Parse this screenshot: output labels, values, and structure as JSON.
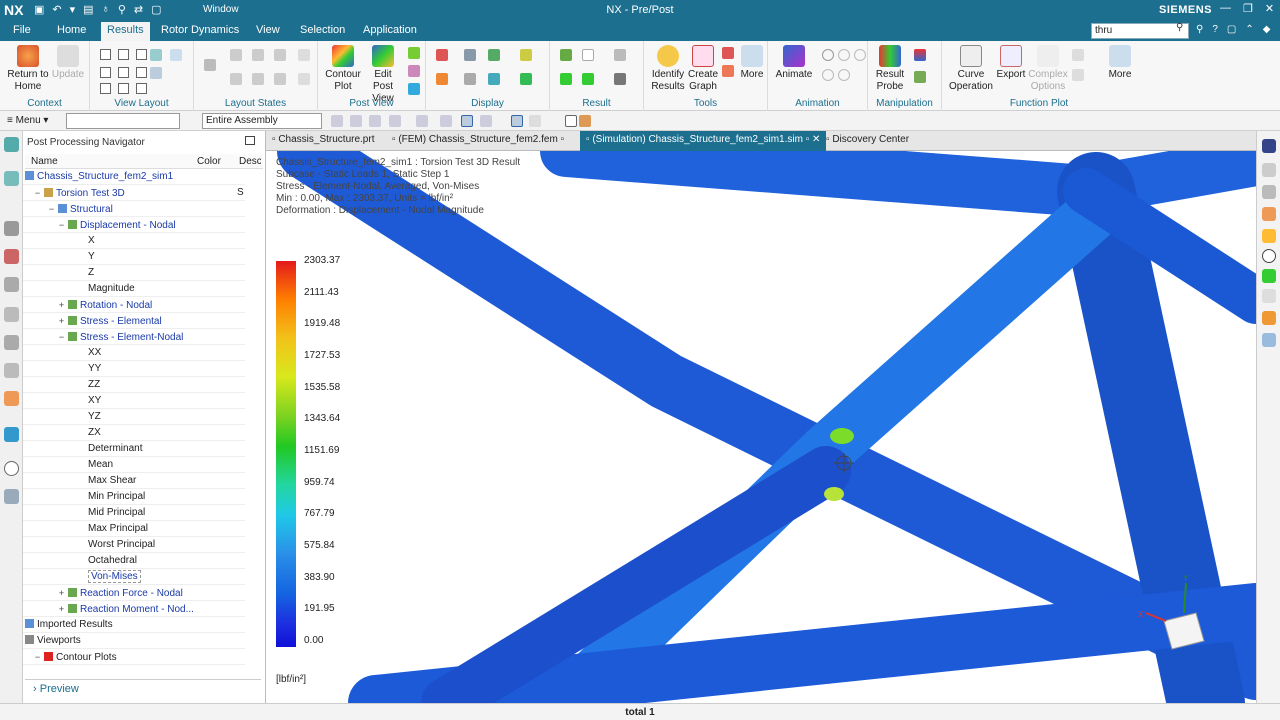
{
  "titlebar": {
    "logo": "NX",
    "window_label": "Window",
    "title": "NX - Pre/Post",
    "brand": "SIEMENS"
  },
  "menu": {
    "tabs": [
      "File",
      "Home",
      "Results",
      "Rotor Dynamics",
      "View",
      "Selection",
      "Application"
    ],
    "active": "Results",
    "search_value": "thru"
  },
  "ribbon": {
    "context": {
      "label": "Context",
      "return_label": "Return to Home",
      "update_label": "Update"
    },
    "view_layout": {
      "label": "View Layout"
    },
    "layout_states": {
      "label": "Layout States"
    },
    "post_view": {
      "label": "Post View",
      "contour_plot": "Contour Plot",
      "edit_post_view": "Edit Post View"
    },
    "display": {
      "label": "Display"
    },
    "result": {
      "label": "Result"
    },
    "tools": {
      "label": "Tools",
      "identify": "Identify Results",
      "create_graph": "Create Graph",
      "more": "More"
    },
    "animation": {
      "label": "Animation",
      "animate": "Animate"
    },
    "manipulation": {
      "label": "Manipulation",
      "result_probe": "Result Probe"
    },
    "function_plot": {
      "label": "Function Plot",
      "curve_operation": "Curve Operation",
      "export": "Export",
      "complex_options": "Complex Options",
      "more": "More"
    }
  },
  "toolbar2": {
    "menu_label": "Menu",
    "filter_value": "",
    "assembly_value": "Entire Assembly"
  },
  "navigator": {
    "title": "Post Processing Navigator",
    "columns": [
      "Name",
      "Color",
      "Desc"
    ],
    "rows": [
      {
        "label": "Chassis_Structure_fem2_sim1",
        "level": 0,
        "pm": "",
        "icon": "sim"
      },
      {
        "label": "Torsion Test 3D",
        "level": 1,
        "pm": "−",
        "icon": "folder",
        "extra": "S"
      },
      {
        "label": "Structural",
        "level": 2,
        "pm": "−",
        "icon": "structural"
      },
      {
        "label": "Displacement - Nodal",
        "level": 3,
        "pm": "−",
        "icon": "result"
      },
      {
        "label": "X",
        "level": 4,
        "pm": "",
        "icon": ""
      },
      {
        "label": "Y",
        "level": 4,
        "pm": "",
        "icon": ""
      },
      {
        "label": "Z",
        "level": 4,
        "pm": "",
        "icon": ""
      },
      {
        "label": "Magnitude",
        "level": 4,
        "pm": "",
        "icon": ""
      },
      {
        "label": "Rotation - Nodal",
        "level": 3,
        "pm": "+",
        "icon": "result"
      },
      {
        "label": "Stress - Elemental",
        "level": 3,
        "pm": "+",
        "icon": "result"
      },
      {
        "label": "Stress - Element-Nodal",
        "level": 3,
        "pm": "−",
        "icon": "result"
      },
      {
        "label": "XX",
        "level": 4,
        "pm": "",
        "icon": ""
      },
      {
        "label": "YY",
        "level": 4,
        "pm": "",
        "icon": ""
      },
      {
        "label": "ZZ",
        "level": 4,
        "pm": "",
        "icon": ""
      },
      {
        "label": "XY",
        "level": 4,
        "pm": "",
        "icon": ""
      },
      {
        "label": "YZ",
        "level": 4,
        "pm": "",
        "icon": ""
      },
      {
        "label": "ZX",
        "level": 4,
        "pm": "",
        "icon": ""
      },
      {
        "label": "Determinant",
        "level": 4,
        "pm": "",
        "icon": ""
      },
      {
        "label": "Mean",
        "level": 4,
        "pm": "",
        "icon": ""
      },
      {
        "label": "Max Shear",
        "level": 4,
        "pm": "",
        "icon": ""
      },
      {
        "label": "Min Principal",
        "level": 4,
        "pm": "",
        "icon": ""
      },
      {
        "label": "Mid Principal",
        "level": 4,
        "pm": "",
        "icon": ""
      },
      {
        "label": "Max Principal",
        "level": 4,
        "pm": "",
        "icon": ""
      },
      {
        "label": "Worst Principal",
        "level": 4,
        "pm": "",
        "icon": ""
      },
      {
        "label": "Octahedral",
        "level": 4,
        "pm": "",
        "icon": ""
      },
      {
        "label": "Von-Mises",
        "level": 4,
        "pm": "",
        "icon": "",
        "selected": true
      },
      {
        "label": "Reaction Force - Nodal",
        "level": 3,
        "pm": "+",
        "icon": "result"
      },
      {
        "label": "Reaction Moment - Nod...",
        "level": 3,
        "pm": "+",
        "icon": "result"
      },
      {
        "label": "Imported Results",
        "level": 0,
        "pm": "",
        "icon": "sim"
      },
      {
        "label": "Viewports",
        "level": 0,
        "pm": "",
        "icon": "viewport"
      },
      {
        "label": "Contour Plots",
        "level": 1,
        "pm": "−",
        "icon": "red"
      }
    ],
    "preview_label": "Preview"
  },
  "doc_tabs": [
    "Chassis_Structure.prt",
    "(FEM) Chassis_Structure_fem2.fem",
    "(Simulation) Chassis_Structure_fem2_sim1.sim",
    "Discovery Center"
  ],
  "active_doc_tab": 2,
  "viewport": {
    "info_lines": [
      "Chassis_Structure_fem2_sim1 : Torsion Test 3D Result",
      "Subcase - Static Loads 1, Static Step 1",
      "Stress - Element-Nodal, Averaged, Von-Mises",
      "Min : 0.00, Max : 2303.37, Units = lbf/in²",
      "Deformation : Displacement - Nodal Magnitude"
    ],
    "legend_values": [
      "2303.37",
      "2111.43",
      "1919.48",
      "1727.53",
      "1535.58",
      "1343.64",
      "1151.69",
      "959.74",
      "767.79",
      "575.84",
      "383.90",
      "191.95",
      "0.00"
    ],
    "units": "[lbf/in²]",
    "triad": {
      "x": "X",
      "y": "Y"
    }
  },
  "status": {
    "text": "total 1"
  }
}
